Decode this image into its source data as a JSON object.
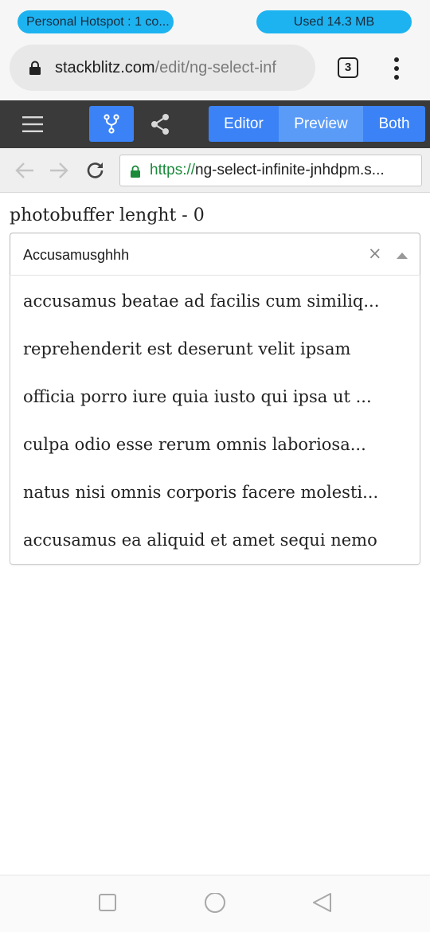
{
  "status_bar": {
    "hotspot": "Personal Hotspot : 1 co...",
    "data_used": "Used  14.3 MB"
  },
  "browser": {
    "url_host": "stackblitz.com",
    "url_path": "/edit/ng-select-inf",
    "tab_count": "3"
  },
  "stackblitz": {
    "views": [
      "Editor",
      "Preview",
      "Both"
    ],
    "active_view": "Preview"
  },
  "preview_nav": {
    "url_scheme": "https://",
    "url_rest": "ng-select-infinite-jnhdpm.s..."
  },
  "page": {
    "heading": "photobuffer lenght - 0",
    "select_value": "Accusamusghhh",
    "clear_glyph": "×",
    "options": [
      "accusamus beatae ad facilis cum similiq...",
      "reprehenderit est deserunt velit ipsam",
      "officia porro iure quia iusto qui ipsa ut ...",
      "culpa odio esse rerum omnis laboriosa...",
      "natus nisi omnis corporis facere molesti...",
      "accusamus ea aliquid et amet sequi nemo"
    ]
  },
  "colors": {
    "status_pill": "#1db3f0",
    "stackblitz_blue": "#3b82f6",
    "toolbar_dark": "#3a3a3a",
    "secure_green": "#1b8a3a"
  }
}
